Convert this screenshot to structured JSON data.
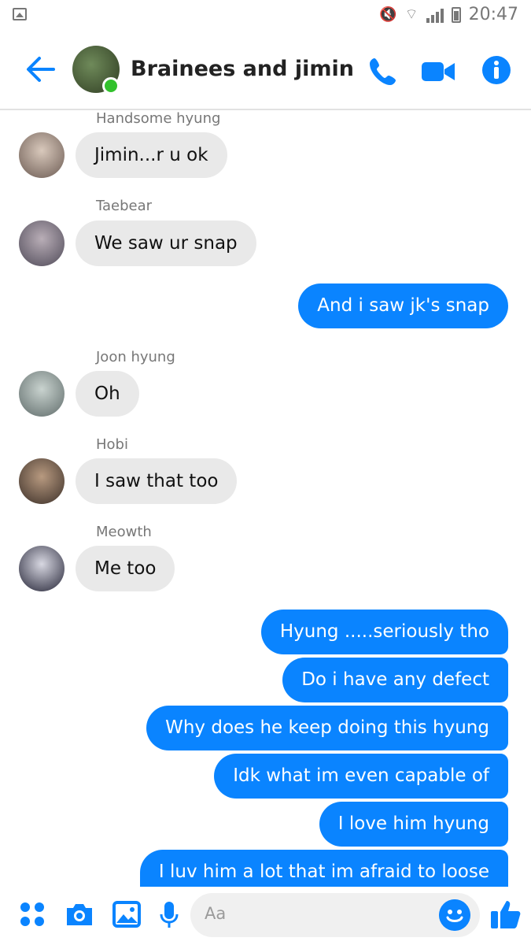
{
  "status_bar": {
    "time": "20:47"
  },
  "header": {
    "title": "Brainees and jimin"
  },
  "messages": [
    {
      "sender": "Handsome hyung",
      "text": "Jimin...r u ok"
    },
    {
      "sender": "Taebear",
      "text": "We saw ur snap"
    },
    {
      "text": "And i saw jk's snap"
    },
    {
      "sender": "Joon hyung",
      "text": "Oh"
    },
    {
      "sender": "Hobi",
      "text": "I saw that too"
    },
    {
      "sender": "Meowth",
      "text": "Me too"
    },
    {
      "text": "Hyung .....seriously tho"
    },
    {
      "text": "Do i have any defect"
    },
    {
      "text": "Why does he keep doing this hyung"
    },
    {
      "text": "Idk what im even capable of"
    },
    {
      "text": "I love him hyung"
    },
    {
      "text": "I luv him a lot that im afraid to loose"
    }
  ],
  "composer": {
    "placeholder": "Aa"
  },
  "colors": {
    "accent": "#0a84ff",
    "incoming_bubble": "#e9e9e9",
    "online": "#32c12c"
  }
}
